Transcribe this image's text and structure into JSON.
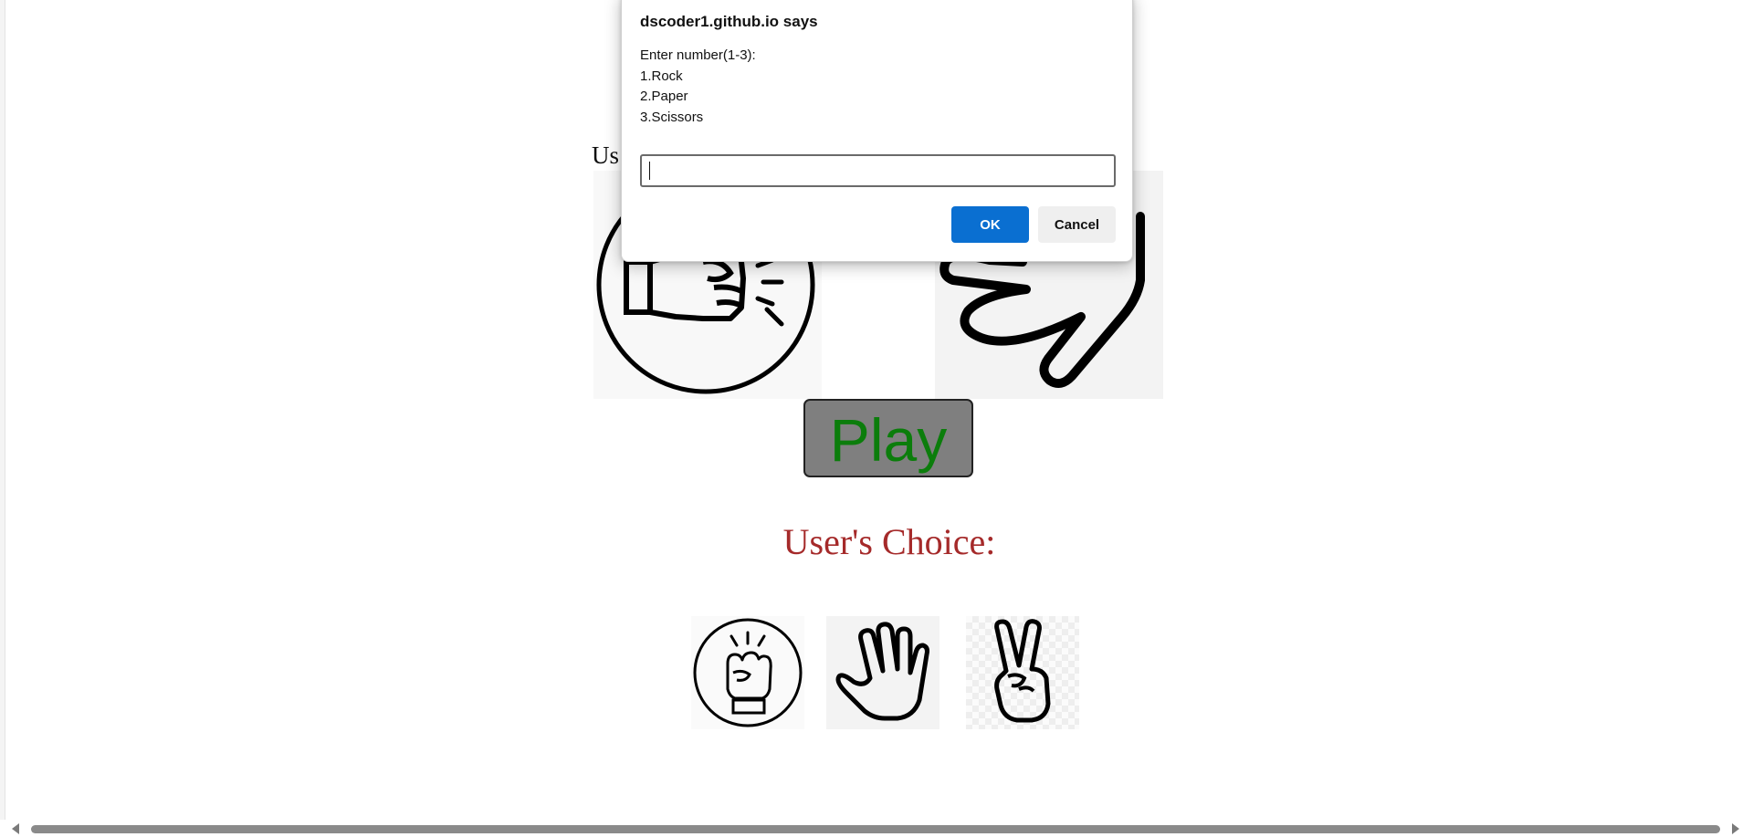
{
  "page": {
    "heading_partial": "Us",
    "play_label": "Play",
    "users_choice_label": "User's Choice:",
    "choices": [
      {
        "name": "rock",
        "icon": "rock-fist-icon"
      },
      {
        "name": "paper",
        "icon": "paper-hand-icon"
      },
      {
        "name": "scissors",
        "icon": "scissors-peace-icon"
      }
    ],
    "colors": {
      "play_text": "#0b7d0b",
      "play_bg": "#7f7f7f",
      "users_choice": "#a52a2a"
    }
  },
  "dialog": {
    "title": "dscoder1.github.io says",
    "message_lines": [
      "Enter number(1-3):",
      "1.Rock",
      "2.Paper",
      "3.Scissors"
    ],
    "input_value": "",
    "ok_label": "OK",
    "cancel_label": "Cancel",
    "ok_color": "#0a6fd1"
  }
}
